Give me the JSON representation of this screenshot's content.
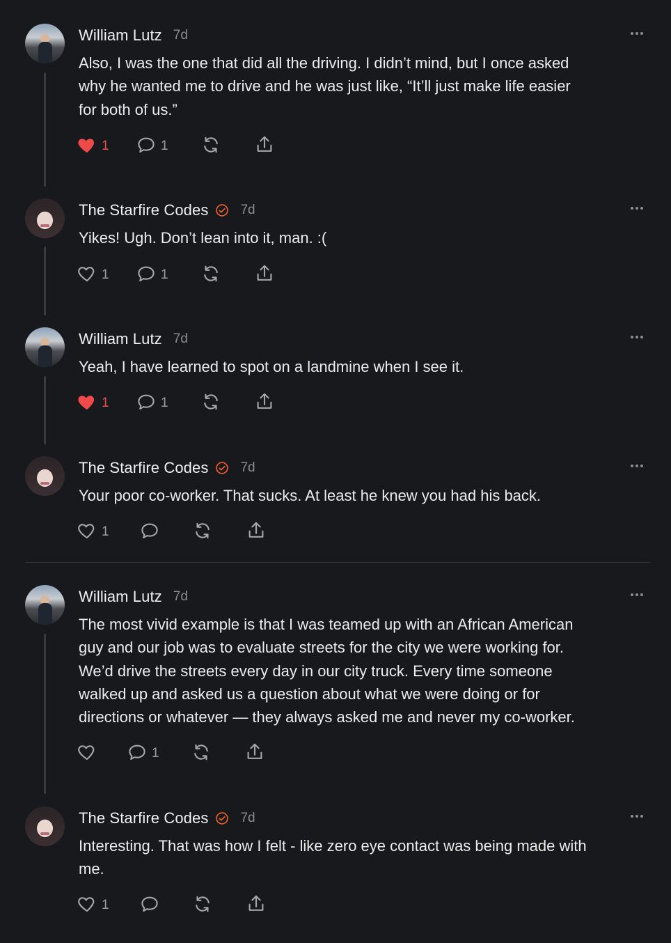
{
  "comments": [
    {
      "author": "William Lutz",
      "avatar": "william-lutz-avatar",
      "verified": false,
      "time": "7d",
      "lines": [
        "Also, I was the one that did all the driving. I didn’t mind, but I once asked",
        "why he wanted me to drive and he was just like, “It’ll just make life easier",
        "for both of us.”"
      ],
      "likes": "1",
      "liked": true,
      "replies": "1"
    },
    {
      "author": "The Starfire Codes",
      "avatar": "starfire-codes-avatar",
      "verified": true,
      "time": "7d",
      "lines": [
        "Yikes! Ugh. Don’t lean into it, man. :("
      ],
      "likes": "1",
      "liked": false,
      "replies": "1"
    },
    {
      "author": "William Lutz",
      "avatar": "william-lutz-avatar",
      "verified": false,
      "time": "7d",
      "lines": [
        "Yeah, I have learned to spot on a landmine when I see it."
      ],
      "likes": "1",
      "liked": true,
      "replies": "1"
    },
    {
      "author": "The Starfire Codes",
      "avatar": "starfire-codes-avatar",
      "verified": true,
      "time": "7d",
      "lines": [
        "Your poor co-worker. That sucks. At least he knew you had his back."
      ],
      "likes": "1",
      "liked": false,
      "replies": ""
    },
    {
      "author": "William Lutz",
      "avatar": "william-lutz-avatar",
      "verified": false,
      "time": "7d",
      "lines": [
        "The most vivid example is that I was teamed up with an African American",
        "guy and our job was to evaluate streets for the city we were working for.",
        "We’d drive the streets every day in our city truck. Every time someone",
        "walked up and asked us a question about what we were doing or for",
        "directions or whatever — they always asked me and never my co-worker."
      ],
      "likes": "",
      "liked": false,
      "replies": "1"
    },
    {
      "author": "The Starfire Codes",
      "avatar": "starfire-codes-avatar",
      "verified": true,
      "time": "7d",
      "lines": [
        "Interesting. That was how I felt - like zero eye contact was being made with",
        "me."
      ],
      "likes": "1",
      "liked": false,
      "replies": ""
    }
  ],
  "colors": {
    "background": "#17191c",
    "liked": "#ef4a4a",
    "verified": "#f0602a",
    "muted": "#8b8d91"
  }
}
